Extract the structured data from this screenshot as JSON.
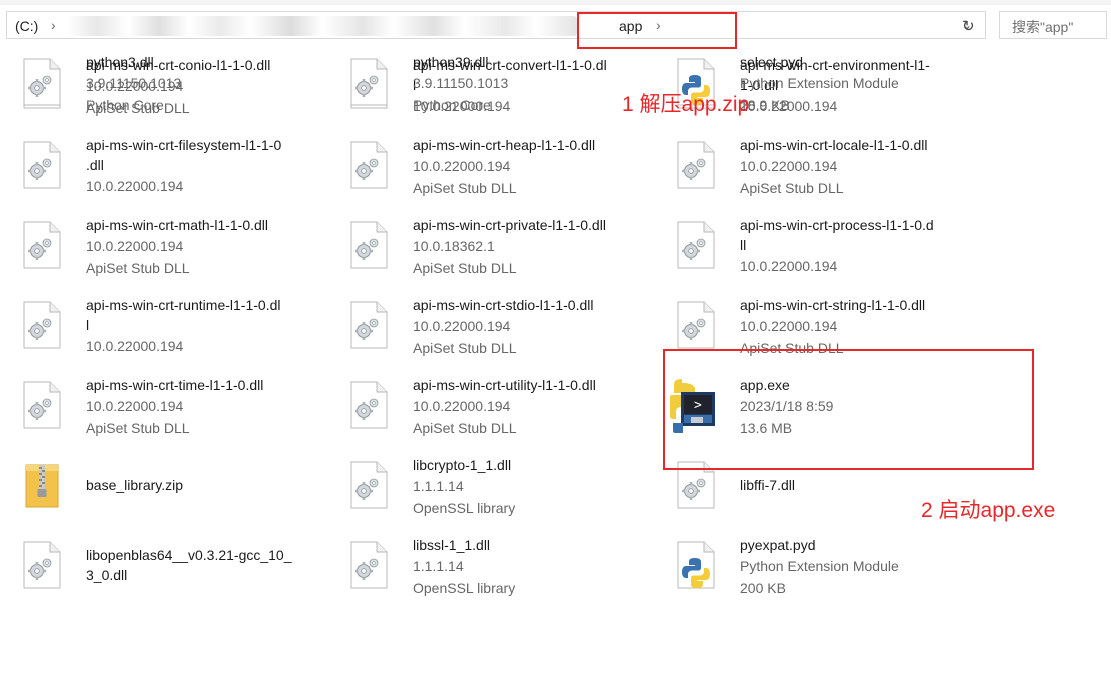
{
  "address_bar": {
    "root": "(C:)",
    "separator": "›",
    "current": "app",
    "current_separator": "›",
    "dropdown": "⌄",
    "refresh": "↻",
    "search_placeholder": "搜索\"app\""
  },
  "files": [
    {
      "name": "api-ms-win-crt-conio-l1-1-0.dll",
      "line2": "10.0.22000.194",
      "line3": "ApiSet Stub DLL",
      "icon": "dll-icon"
    },
    {
      "name": "api-ms-win-crt-convert-l1-1-0.dl\nl",
      "line2": "10.0.22000.194",
      "line3": "",
      "icon": "dll-icon"
    },
    {
      "name": "api-ms-win-crt-environment-l1-\n1-0.dll",
      "line2": "10.0.22000.194",
      "line3": "",
      "icon": "dll-icon"
    },
    {
      "name": "api-ms-win-crt-filesystem-l1-1-0\n.dll",
      "line2": "10.0.22000.194",
      "line3": "",
      "icon": "dll-icon"
    },
    {
      "name": "api-ms-win-crt-heap-l1-1-0.dll",
      "line2": "10.0.22000.194",
      "line3": "ApiSet Stub DLL",
      "icon": "dll-icon"
    },
    {
      "name": "api-ms-win-crt-locale-l1-1-0.dll",
      "line2": "10.0.22000.194",
      "line3": "ApiSet Stub DLL",
      "icon": "dll-icon"
    },
    {
      "name": "api-ms-win-crt-math-l1-1-0.dll",
      "line2": "10.0.22000.194",
      "line3": "ApiSet Stub DLL",
      "icon": "dll-icon"
    },
    {
      "name": "api-ms-win-crt-private-l1-1-0.dll",
      "line2": "10.0.18362.1",
      "line3": "ApiSet Stub DLL",
      "icon": "dll-icon"
    },
    {
      "name": "api-ms-win-crt-process-l1-1-0.d\nll",
      "line2": "10.0.22000.194",
      "line3": "",
      "icon": "dll-icon"
    },
    {
      "name": "api-ms-win-crt-runtime-l1-1-0.dl\nl",
      "line2": "10.0.22000.194",
      "line3": "",
      "icon": "dll-icon"
    },
    {
      "name": "api-ms-win-crt-stdio-l1-1-0.dll",
      "line2": "10.0.22000.194",
      "line3": "ApiSet Stub DLL",
      "icon": "dll-icon"
    },
    {
      "name": "api-ms-win-crt-string-l1-1-0.dll",
      "line2": "10.0.22000.194",
      "line3": "ApiSet Stub DLL",
      "icon": "dll-icon"
    },
    {
      "name": "api-ms-win-crt-time-l1-1-0.dll",
      "line2": "10.0.22000.194",
      "line3": "ApiSet Stub DLL",
      "icon": "dll-icon"
    },
    {
      "name": "api-ms-win-crt-utility-l1-1-0.dll",
      "line2": "10.0.22000.194",
      "line3": "ApiSet Stub DLL",
      "icon": "dll-icon"
    },
    {
      "name": "app.exe",
      "line2": "2023/1/18 8:59",
      "line3": "13.6 MB",
      "icon": "python-exe-icon"
    },
    {
      "name": "base_library.zip",
      "line2": "",
      "line3": "",
      "icon": "zip-folder-icon"
    },
    {
      "name": "libcrypto-1_1.dll",
      "line2": "1.1.1.14",
      "line3": "OpenSSL library",
      "icon": "dll-icon"
    },
    {
      "name": "libffi-7.dll",
      "line2": "",
      "line3": "",
      "icon": "dll-icon"
    },
    {
      "name": "libopenblas64__v0.3.21-gcc_10_\n3_0.dll",
      "line2": "",
      "line3": "",
      "icon": "dll-icon"
    },
    {
      "name": "libssl-1_1.dll",
      "line2": "1.1.1.14",
      "line3": "OpenSSL library",
      "icon": "dll-icon"
    },
    {
      "name": "pyexpat.pyd",
      "line2": "Python Extension Module",
      "line3": "200 KB",
      "icon": "python-file-icon"
    },
    {
      "name": "python3.dll",
      "line2": "3.9.11150.1013",
      "line3": "Python Core",
      "icon": "dll-icon"
    },
    {
      "name": "python39.dll",
      "line2": "3.9.11150.1013",
      "line3": "Python Core",
      "icon": "dll-icon"
    },
    {
      "name": "select.pyd",
      "line2": "Python Extension Module",
      "line3": "28.9 KB",
      "icon": "python-file-icon"
    }
  ],
  "annotations": {
    "step1": "1 解压app.zip",
    "step2": "2 启动app.exe",
    "color": "#e8272b"
  }
}
